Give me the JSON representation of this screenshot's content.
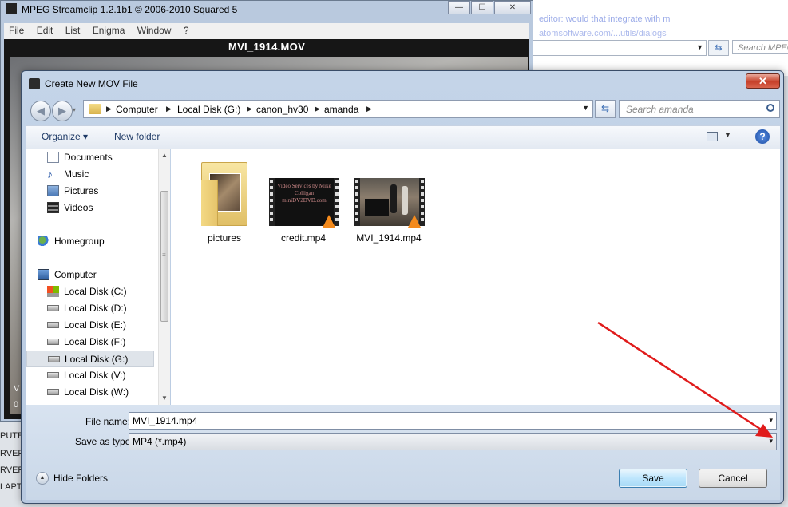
{
  "background_browser": {
    "blur_line_1": "editor: would that integrate with m",
    "blur_line_2": "atomsoftware.com/...utils/dialogs",
    "search_placeholder": "Search MPEG"
  },
  "left_sliver": [
    "PUTER",
    "RVER",
    "RVER",
    "LAPT"
  ],
  "streamclip": {
    "title": "MPEG Streamclip 1.2.1b1  ©  2006-2010 Squared 5",
    "menu": [
      "File",
      "Edit",
      "List",
      "Enigma",
      "Window",
      "?"
    ],
    "filename": "MVI_1914.MOV",
    "controls": {
      "minimize": "—",
      "maximize": "☐",
      "close": "✕"
    },
    "side_glyph_1": "V",
    "side_glyph_2": "0"
  },
  "dialog": {
    "title": "Create New MOV File",
    "close": "✕",
    "nav": {
      "back": "◀",
      "forward": "▶",
      "recent": "▾"
    },
    "breadcrumb": [
      "Computer",
      "Local Disk (G:)",
      "canon_hv30",
      "amanda"
    ],
    "breadcrumb_sep": "▶",
    "search_placeholder": "Search amanda",
    "toolbar": {
      "organize": "Organize ▾",
      "new_folder": "New folder",
      "help": "?"
    },
    "sidebar": [
      {
        "label": "Documents",
        "icon": "documents-icon"
      },
      {
        "label": "Music",
        "icon": "music-icon"
      },
      {
        "label": "Pictures",
        "icon": "pictures-icon"
      },
      {
        "label": "Videos",
        "icon": "videos-icon"
      },
      {
        "label": "Homegroup",
        "icon": "homegroup-icon"
      },
      {
        "label": "Computer",
        "icon": "computer-icon"
      },
      {
        "label": "Local Disk (C:)",
        "icon": "windows-drive-icon"
      },
      {
        "label": "Local Disk (D:)",
        "icon": "drive-icon"
      },
      {
        "label": "Local Disk (E:)",
        "icon": "drive-icon"
      },
      {
        "label": "Local Disk (F:)",
        "icon": "drive-icon"
      },
      {
        "label": "Local Disk (G:)",
        "icon": "drive-icon",
        "selected": true
      },
      {
        "label": "Local Disk (V:)",
        "icon": "drive-icon"
      },
      {
        "label": "Local Disk (W:)",
        "icon": "drive-icon"
      }
    ],
    "files": [
      {
        "label": "pictures",
        "type": "folder"
      },
      {
        "label": "credit.mp4",
        "type": "video",
        "overlay_text": "Video Services by Mike Colligan miniDV2DVD.com"
      },
      {
        "label": "MVI_1914.mp4",
        "type": "video"
      }
    ],
    "file_name_label": "File name:",
    "file_name_value": "MVI_1914.mp4",
    "save_type_label": "Save as type:",
    "save_type_value": "MP4 (*.mp4)",
    "dropdown_glyph": "▾",
    "hide_folders": "Hide Folders",
    "save_button": "Save",
    "cancel_button": "Cancel"
  },
  "colors": {
    "annotation_arrow": "#e01b1b",
    "accent": "#3c7fb1"
  }
}
